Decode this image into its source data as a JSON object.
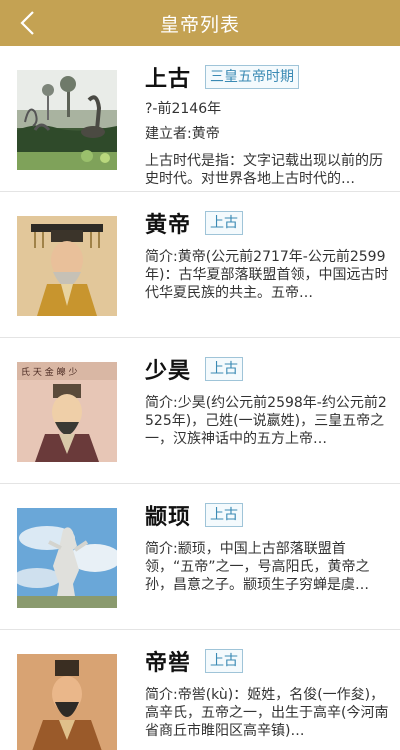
{
  "header": {
    "title": "皇帝列表",
    "back_icon": "chevron-left-icon"
  },
  "colors": {
    "header_bg": "#c4a253",
    "badge_text": "#3a8ab4",
    "badge_border": "#9fc4d8"
  },
  "items": [
    {
      "name": "上古",
      "badge": "三皇五帝时期",
      "period": "?-前2146年",
      "founder": "建立者:黄帝",
      "desc": "上古时代是指：文字记载出现以前的历史时代。对世界各地上古时代的…",
      "image": "dinosaur-scene"
    },
    {
      "name": "黄帝",
      "badge": "上古",
      "desc": "简介:黄帝(公元前2717年-公元前2599年)：古华夏部落联盟首领，中国远古时代华夏民族的共主。五帝…",
      "image": "emperor-portrait"
    },
    {
      "name": "少昊",
      "badge": "上古",
      "desc": "简介:少昊(约公元前2598年-约公元前2525年)，己姓(一说嬴姓)，三皇五帝之一，汉族神话中的五方上帝…",
      "image": "emperor-portrait"
    },
    {
      "name": "颛顼",
      "badge": "上古",
      "desc": "简介:颛顼，中国上古部落联盟首领，“五帝”之一，号高阳氏，黄帝之孙，昌意之子。颛顼生子穷蝉是虞…",
      "image": "statue"
    },
    {
      "name": "帝喾",
      "badge": "上古",
      "desc": "简介:帝喾(kù)：姬姓，名俊(一作夋)，高辛氏，五帝之一，出生于高辛(今河南省商丘市睢阳区高辛镇)…",
      "image": "emperor-portrait"
    }
  ]
}
